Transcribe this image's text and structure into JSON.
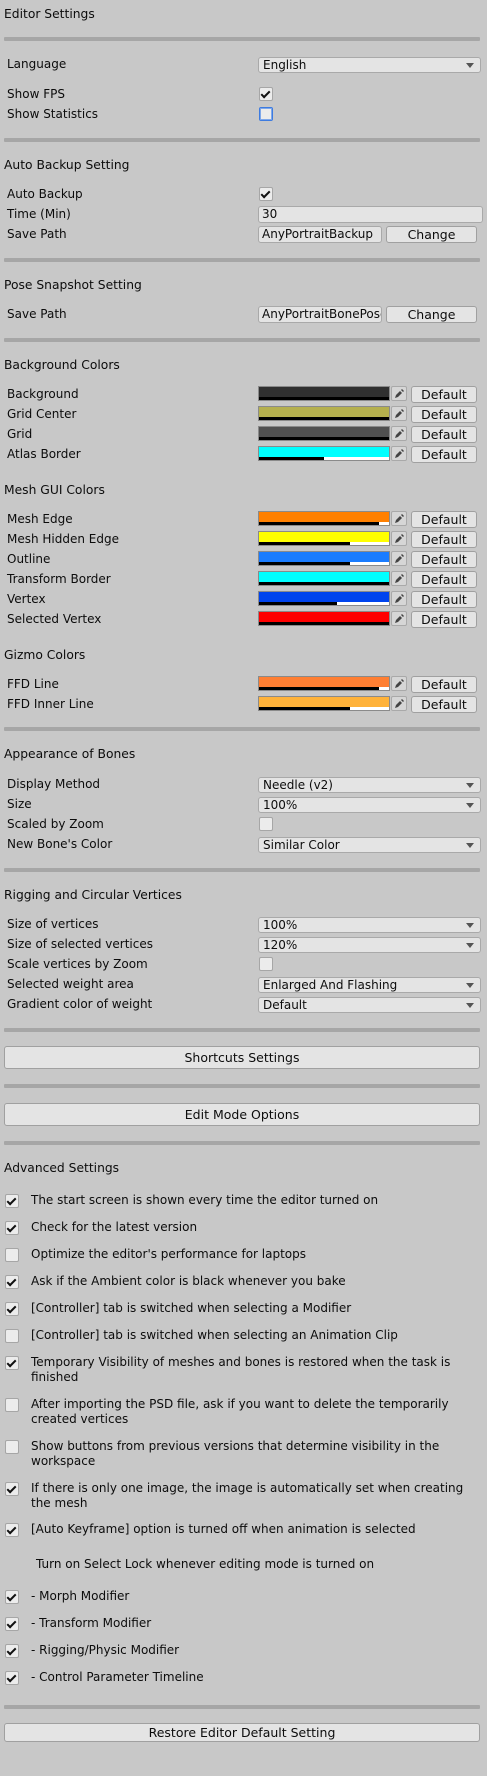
{
  "editor_settings": {
    "title": "Editor Settings",
    "language_label": "Language",
    "language_value": "English",
    "show_fps_label": "Show FPS",
    "show_fps_checked": true,
    "show_statistics_label": "Show Statistics",
    "show_statistics_checked": false
  },
  "auto_backup": {
    "title": "Auto Backup Setting",
    "auto_backup_label": "Auto Backup",
    "auto_backup_checked": true,
    "time_label": "Time (Min)",
    "time_value": "30",
    "save_path_label": "Save Path",
    "save_path_value": "AnyPortraitBackup",
    "change_label": "Change"
  },
  "pose_snapshot": {
    "title": "Pose Snapshot Setting",
    "save_path_label": "Save Path",
    "save_path_value": "AnyPortraitBonePose",
    "change_label": "Change"
  },
  "background_colors": {
    "title": "Background Colors",
    "items": [
      {
        "label": "Background",
        "color": "#303030",
        "alpha": 1.0,
        "default_label": "Default"
      },
      {
        "label": "Grid Center",
        "color": "#b5b04e",
        "alpha": 1.0,
        "default_label": "Default"
      },
      {
        "label": "Grid",
        "color": "#505050",
        "alpha": 1.0,
        "default_label": "Default"
      },
      {
        "label": "Atlas Border",
        "color": "#00ffff",
        "alpha": 0.5,
        "default_label": "Default"
      }
    ]
  },
  "mesh_gui_colors": {
    "title": "Mesh GUI Colors",
    "items": [
      {
        "label": "Mesh Edge",
        "color": "#ff8000",
        "alpha": 0.92,
        "default_label": "Default"
      },
      {
        "label": "Mesh Hidden Edge",
        "color": "#ffff00",
        "alpha": 0.7,
        "default_label": "Default"
      },
      {
        "label": "Outline",
        "color": "#1a7cff",
        "alpha": 0.7,
        "default_label": "Default"
      },
      {
        "label": "Transform Border",
        "color": "#00ffff",
        "alpha": 1.0,
        "default_label": "Default"
      },
      {
        "label": "Vertex",
        "color": "#0044ee",
        "alpha": 0.6,
        "default_label": "Default"
      },
      {
        "label": "Selected Vertex",
        "color": "#ff0000",
        "alpha": 1.0,
        "default_label": "Default"
      }
    ]
  },
  "gizmo_colors": {
    "title": "Gizmo Colors",
    "items": [
      {
        "label": "FFD Line",
        "color": "#ff7f33",
        "alpha": 0.92,
        "default_label": "Default"
      },
      {
        "label": "FFD Inner Line",
        "color": "#ffb23a",
        "alpha": 0.7,
        "default_label": "Default"
      }
    ]
  },
  "appearance_of_bones": {
    "title": "Appearance of Bones",
    "display_method_label": "Display Method",
    "display_method_value": "Needle (v2)",
    "size_label": "Size",
    "size_value": "100%",
    "scaled_by_zoom_label": "Scaled by Zoom",
    "scaled_by_zoom_checked": false,
    "new_bone_color_label": "New Bone's Color",
    "new_bone_color_value": "Similar Color"
  },
  "rigging": {
    "title": "Rigging and Circular Vertices",
    "size_of_vertices_label": "Size of vertices",
    "size_of_vertices_value": "100%",
    "size_of_selected_label": "Size of selected vertices",
    "size_of_selected_value": "120%",
    "scale_by_zoom_label": "Scale vertices by Zoom",
    "scale_by_zoom_checked": false,
    "selected_weight_area_label": "Selected weight area",
    "selected_weight_area_value": "Enlarged And Flashing",
    "gradient_color_label": "Gradient color of weight",
    "gradient_color_value": "Default"
  },
  "buttons": {
    "shortcuts": "Shortcuts Settings",
    "edit_mode": "Edit Mode Options",
    "restore": "Restore Editor Default Setting"
  },
  "advanced": {
    "title": "Advanced Settings",
    "items": [
      {
        "label": "The start screen is shown every time the editor turned on",
        "checked": true
      },
      {
        "label": "Check for the latest version",
        "checked": true
      },
      {
        "label": "Optimize the editor's performance for laptops",
        "checked": false
      },
      {
        "label": "Ask if the Ambient color is black whenever you bake",
        "checked": true
      },
      {
        "label": "[Controller] tab is switched when selecting a Modifier",
        "checked": true
      },
      {
        "label": "[Controller] tab is switched when selecting an Animation Clip",
        "checked": false
      },
      {
        "label": "Temporary Visibility of meshes and bones is restored when the task is finished",
        "checked": true
      },
      {
        "label": "After importing the PSD file, ask if you want to delete the temporarily created vertices",
        "checked": false
      },
      {
        "label": "Show buttons from previous versions that determine visibility in the workspace",
        "checked": false
      },
      {
        "label": "If there is only one image, the image is automatically set when creating the mesh",
        "checked": true
      },
      {
        "label": "[Auto Keyframe] option is turned off when animation is selected",
        "checked": true
      }
    ],
    "select_lock_title": "Turn on Select Lock whenever editing mode is turned on",
    "select_lock_items": [
      {
        "label": "- Morph Modifier",
        "checked": true
      },
      {
        "label": "- Transform Modifier",
        "checked": true
      },
      {
        "label": "- Rigging/Physic Modifier",
        "checked": true
      },
      {
        "label": "- Control Parameter Timeline",
        "checked": true
      }
    ]
  }
}
